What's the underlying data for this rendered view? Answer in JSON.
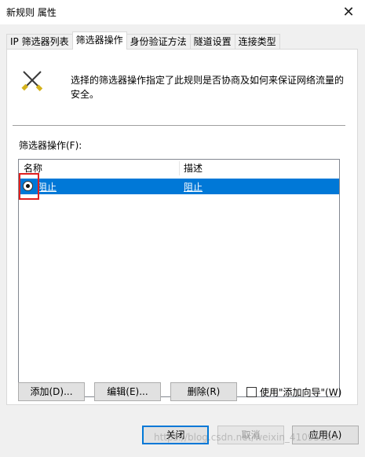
{
  "window": {
    "title": "新规则 属性",
    "close_glyph": "✕"
  },
  "tabs": [
    {
      "label": "IP 筛选器列表",
      "active": false
    },
    {
      "label": "筛选器操作",
      "active": true
    },
    {
      "label": "身份验证方法",
      "active": false
    },
    {
      "label": "隧道设置",
      "active": false
    },
    {
      "label": "连接类型",
      "active": false
    }
  ],
  "panel": {
    "icon": "crossed-tools-icon",
    "description": "选择的筛选器操作指定了此规则是否协商及如何来保证网络流量的安全。",
    "list_label": "筛选器操作(F):",
    "columns": [
      "名称",
      "描述"
    ],
    "rows": [
      {
        "selected": true,
        "name": "阻止",
        "description": "阻止"
      }
    ],
    "buttons": {
      "add": "添加(D)...",
      "edit": "编辑(E)...",
      "delete": "删除(R)"
    },
    "wizard_checkbox": {
      "label": "使用\"添加向导\"(W)",
      "checked": false
    }
  },
  "footer": {
    "close": "关闭",
    "cancel": "取消",
    "apply": "应用(A)"
  },
  "watermark": "https://blog.csdn.net/weixin_41095133",
  "colors": {
    "selection": "#0078d7",
    "highlight_box": "#e02020",
    "content_bg": "#f0f0f0"
  }
}
